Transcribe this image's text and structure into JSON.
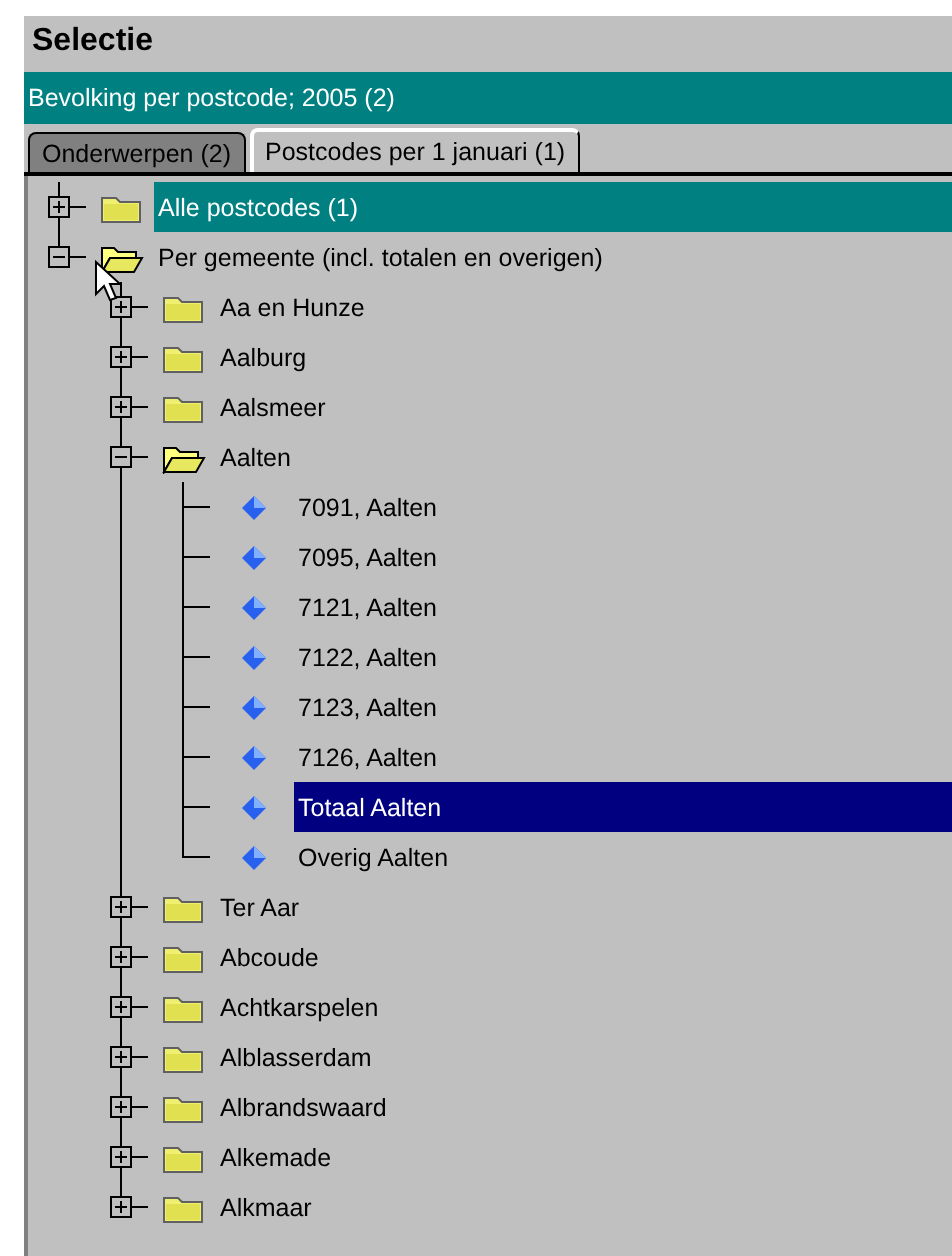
{
  "window": {
    "title": "Selectie"
  },
  "dataset": {
    "title": "Bevolking per postcode; 2005 (2)"
  },
  "tabs": [
    {
      "label": "Onderwerpen (2)",
      "selected": false
    },
    {
      "label": "Postcodes per 1 januari (1)",
      "selected": true
    }
  ],
  "tree": [
    {
      "kind": "folder",
      "label": "Alle postcodes (1)",
      "expanded": false,
      "marked": true,
      "selected": false
    },
    {
      "kind": "folder",
      "label": "Per gemeente (incl. totalen en overigen)",
      "expanded": true,
      "marked": false,
      "selected": false,
      "children": [
        {
          "kind": "folder",
          "label": "Aa en Hunze",
          "expanded": false,
          "marked": false,
          "selected": false
        },
        {
          "kind": "folder",
          "label": "Aalburg",
          "expanded": false,
          "marked": false,
          "selected": false
        },
        {
          "kind": "folder",
          "label": "Aalsmeer",
          "expanded": false,
          "marked": false,
          "selected": false
        },
        {
          "kind": "folder",
          "label": "Aalten",
          "expanded": true,
          "marked": false,
          "selected": false,
          "children": [
            {
              "kind": "leaf",
              "label": "7091, Aalten",
              "marked": false,
              "selected": false
            },
            {
              "kind": "leaf",
              "label": "7095, Aalten",
              "marked": false,
              "selected": false
            },
            {
              "kind": "leaf",
              "label": "7121, Aalten",
              "marked": false,
              "selected": false
            },
            {
              "kind": "leaf",
              "label": "7122, Aalten",
              "marked": false,
              "selected": false
            },
            {
              "kind": "leaf",
              "label": "7123, Aalten",
              "marked": false,
              "selected": false
            },
            {
              "kind": "leaf",
              "label": "7126, Aalten",
              "marked": false,
              "selected": false
            },
            {
              "kind": "leaf",
              "label": "Totaal Aalten",
              "marked": false,
              "selected": true
            },
            {
              "kind": "leaf",
              "label": "Overig Aalten",
              "marked": false,
              "selected": false
            }
          ]
        },
        {
          "kind": "folder",
          "label": "Ter Aar",
          "expanded": false,
          "marked": false,
          "selected": false
        },
        {
          "kind": "folder",
          "label": "Abcoude",
          "expanded": false,
          "marked": false,
          "selected": false
        },
        {
          "kind": "folder",
          "label": "Achtkarspelen",
          "expanded": false,
          "marked": false,
          "selected": false
        },
        {
          "kind": "folder",
          "label": "Alblasserdam",
          "expanded": false,
          "marked": false,
          "selected": false
        },
        {
          "kind": "folder",
          "label": "Albrandswaard",
          "expanded": false,
          "marked": false,
          "selected": false
        },
        {
          "kind": "folder",
          "label": "Alkemade",
          "expanded": false,
          "marked": false,
          "selected": false
        },
        {
          "kind": "folder",
          "label": "Alkmaar",
          "expanded": false,
          "marked": false,
          "selected": false
        }
      ]
    }
  ]
}
